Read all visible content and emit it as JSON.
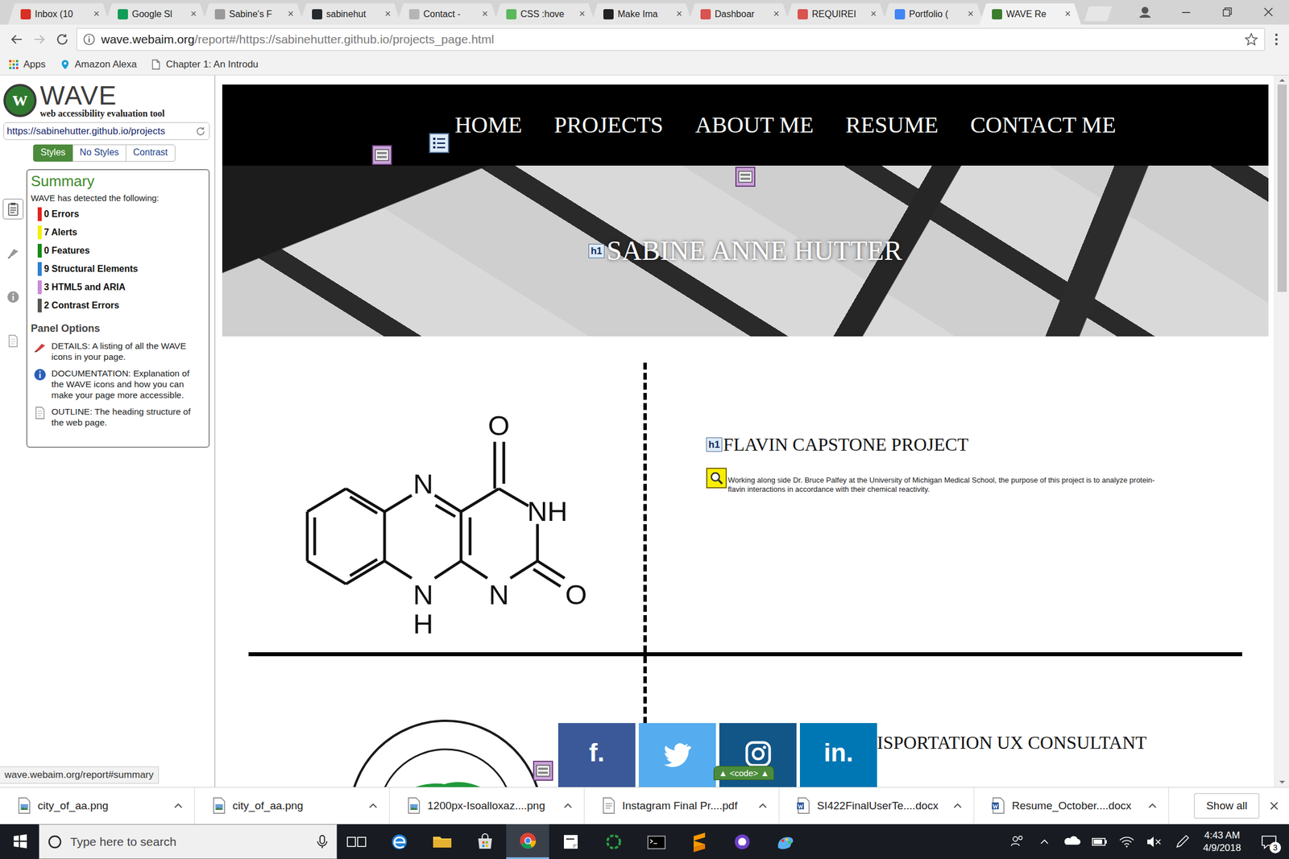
{
  "browser": {
    "tabs": [
      {
        "label": "Inbox (10",
        "selected": false,
        "color": "#d93025"
      },
      {
        "label": "Google Sl",
        "selected": false,
        "color": "#0f9d58"
      },
      {
        "label": "Sabine's F",
        "selected": false,
        "color": "#9a9a9a"
      },
      {
        "label": "sabinehut",
        "selected": false,
        "color": "#24292e"
      },
      {
        "label": "Contact -",
        "selected": false,
        "color": "#b5b5b5"
      },
      {
        "label": "CSS :hove",
        "selected": false,
        "color": "#5cb85c"
      },
      {
        "label": "Make Ima",
        "selected": false,
        "color": "#222222"
      },
      {
        "label": "Dashboar",
        "selected": false,
        "color": "#d9534f"
      },
      {
        "label": "REQUIREI",
        "selected": false,
        "color": "#d9534f"
      },
      {
        "label": "Portfolio (",
        "selected": false,
        "color": "#4285f4"
      },
      {
        "label": "WAVE Re",
        "selected": true,
        "color": "#3a7d2c"
      }
    ],
    "tab_close": "×",
    "url_host": "wave.webaim.org",
    "url_rest": "/report#/https://sabinehutter.github.io/projects_page.html",
    "bookmarks": [
      {
        "label": "Apps",
        "kind": "apps"
      },
      {
        "label": "Amazon Alexa",
        "kind": "pin"
      },
      {
        "label": "Chapter 1: An Introdu",
        "kind": "page"
      }
    ]
  },
  "wave": {
    "logo_glyph": "w",
    "logo": "WAVE",
    "subtitle": "web accessibility evaluation tool",
    "url": "https://sabinehutter.github.io/projects",
    "views": [
      {
        "label": "Styles",
        "selected": true
      },
      {
        "label": "No Styles",
        "selected": false
      },
      {
        "label": "Contrast",
        "selected": false
      }
    ],
    "side_tools": [
      {
        "kind": "summary",
        "selected": true
      },
      {
        "kind": "details",
        "selected": false
      },
      {
        "kind": "info",
        "selected": false
      },
      {
        "kind": "outline",
        "selected": false
      }
    ],
    "summary_title": "Summary",
    "detected": "WAVE has detected the following:",
    "counts": [
      {
        "text": "0 Errors",
        "color": "#e3231c"
      },
      {
        "text": "7 Alerts",
        "color": "#f3f000"
      },
      {
        "text": "0 Features",
        "color": "#138a13"
      },
      {
        "text": "9 Structural Elements",
        "color": "#2f7fd0"
      },
      {
        "text": "3 HTML5 and ARIA",
        "color": "#c98bdb"
      },
      {
        "text": "2 Contrast Errors",
        "color": "#555555"
      }
    ],
    "panel_title": "Panel Options",
    "options": [
      {
        "text": "DETAILS: A listing of all the WAVE icons in your page.",
        "kind": "flag"
      },
      {
        "text": "DOCUMENTATION: Explanation of the WAVE icons and how you can make your page more accessible.",
        "kind": "info"
      },
      {
        "text": "OUTLINE: The heading structure of the web page.",
        "kind": "doc"
      }
    ],
    "status": "wave.webaim.org/report#summary",
    "code_badge": "▲ <code> ▲"
  },
  "site": {
    "nav": [
      {
        "label": "HOME"
      },
      {
        "label": "PROJECTS"
      },
      {
        "label": "ABOUT ME"
      },
      {
        "label": "RESUME"
      },
      {
        "label": "CONTACT ME"
      }
    ],
    "heading_badge": "h1",
    "name": "SABINE ANNE HUTTER",
    "projects": [
      {
        "title": "FLAVIN CAPSTONE PROJECT",
        "badge": "h1",
        "desc": "Working along side Dr. Bruce Palfey at the University of Michigan Medical School, the purpose of this project is to analyze protein-flavin interactions in accordance with their chemical reactivity.",
        "kind": "molecule"
      },
      {
        "title": "ISPORTATION UX CONSULTANT",
        "kind": "seal"
      }
    ],
    "molecule_labels": [
      "O",
      "N",
      "NH",
      "N",
      "O",
      "N",
      "H"
    ],
    "social": [
      {
        "kind": "letter",
        "glyph": "f.",
        "color": "#3b5998"
      },
      {
        "kind": "bird",
        "color": "#55acee"
      },
      {
        "kind": "camera",
        "color": "#125688"
      },
      {
        "kind": "letter",
        "glyph": "in.",
        "color": "#0077b5"
      }
    ]
  },
  "downloads": {
    "items": [
      {
        "name": "city_of_aa.png",
        "kind": "image"
      },
      {
        "name": "city_of_aa.png",
        "kind": "image"
      },
      {
        "name": "1200px-Isoalloxaz....png",
        "kind": "image"
      },
      {
        "name": "Instagram Final Pr....pdf",
        "kind": "pdf"
      },
      {
        "name": "SI422FinalUserTe....docx",
        "kind": "word"
      },
      {
        "name": "Resume_October....docx",
        "kind": "word"
      }
    ],
    "show_all": "Show all"
  },
  "taskbar": {
    "search": "Type here to search",
    "apps": [
      {
        "kind": "taskview",
        "active": false
      },
      {
        "kind": "edge",
        "active": false
      },
      {
        "kind": "explorer",
        "active": false
      },
      {
        "kind": "store",
        "active": false
      },
      {
        "kind": "chrome",
        "active": true
      },
      {
        "kind": "sticky",
        "active": false
      },
      {
        "kind": "spinner",
        "active": false
      },
      {
        "kind": "terminal",
        "active": false
      },
      {
        "kind": "sublime",
        "active": false
      },
      {
        "kind": "github",
        "active": false
      },
      {
        "kind": "paint",
        "active": false
      }
    ],
    "time": "4:43 AM",
    "date": "4/9/2018",
    "notifications": "3"
  }
}
